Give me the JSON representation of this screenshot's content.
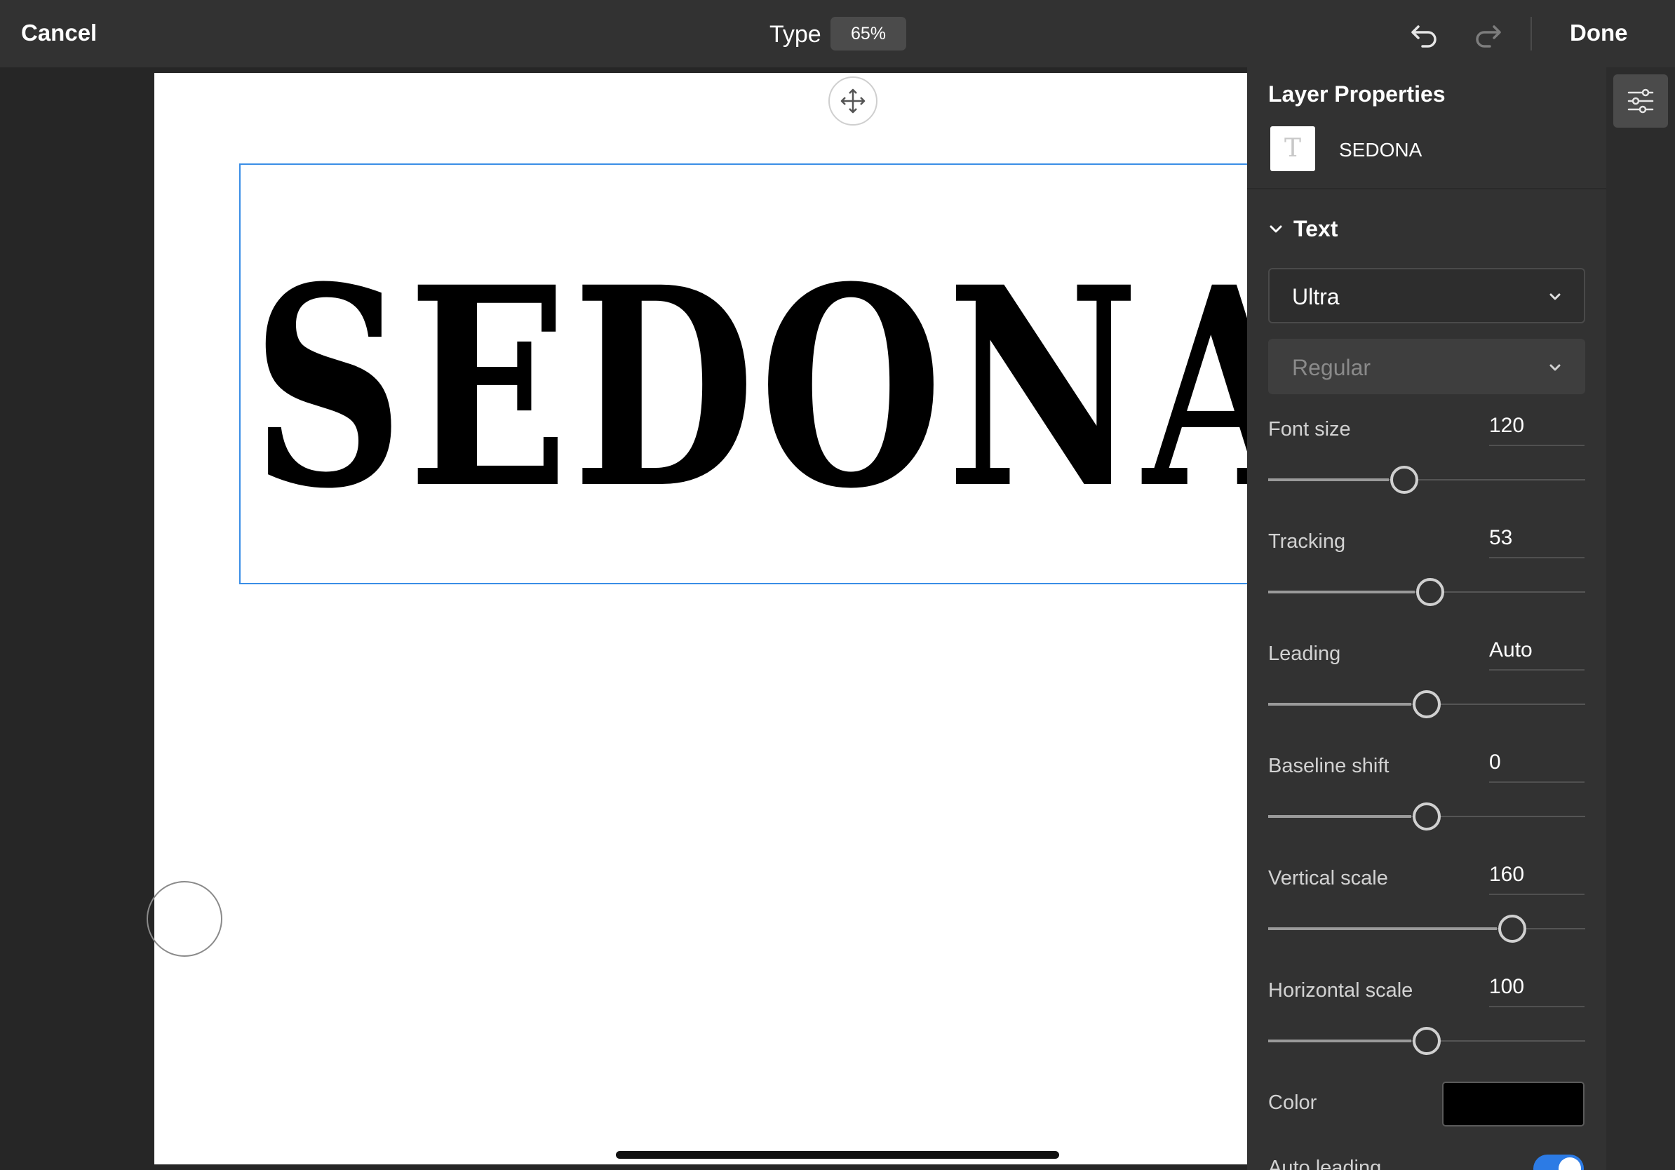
{
  "topbar": {
    "cancel_label": "Cancel",
    "mode_title": "Type",
    "zoom_level": "65%",
    "done_label": "Done",
    "undo_icon": "undo-icon",
    "redo_icon": "redo-icon"
  },
  "canvas": {
    "layer_text": "SEDONA",
    "move_icon": "move-icon"
  },
  "panel": {
    "title": "Layer Properties",
    "layer_name": "SEDONA",
    "layer_thumb_glyph": "T",
    "section_label": "Text",
    "font_family": "Ultra",
    "font_style": "Regular",
    "properties": [
      {
        "label": "Font size",
        "value": "120",
        "level": 0.43
      },
      {
        "label": "Tracking",
        "value": "53",
        "level": 0.51
      },
      {
        "label": "Leading",
        "value": "Auto",
        "level": 0.5
      },
      {
        "label": "Baseline shift",
        "value": "0",
        "level": 0.5
      },
      {
        "label": "Vertical scale",
        "value": "160",
        "level": 0.77
      },
      {
        "label": "Horizontal scale",
        "value": "100",
        "level": 0.5
      }
    ],
    "color_label": "Color",
    "color_value": "#000000",
    "auto_leading_label": "Auto leading",
    "auto_leading_on": true
  },
  "strip": {
    "adjust_icon": "adjustments-icon"
  },
  "colors": {
    "accent": "#3a8ee6",
    "toggle_on": "#2c7be5",
    "panel_bg": "#323232",
    "canvas_bg": "#262626"
  }
}
